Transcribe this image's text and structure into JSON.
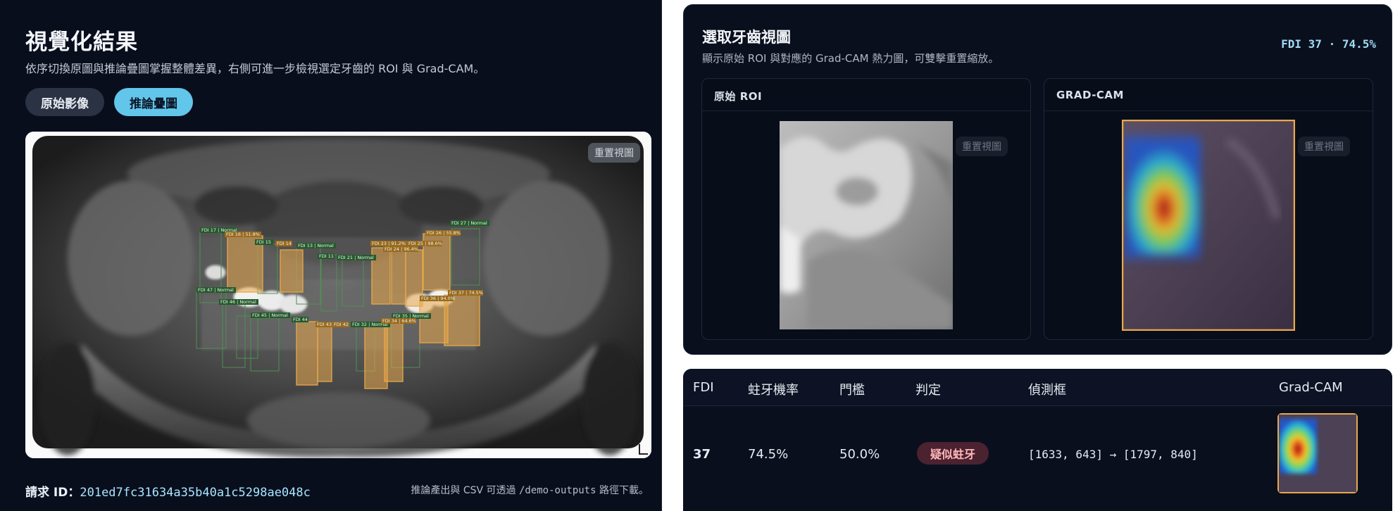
{
  "left": {
    "title": "視覺化結果",
    "subtitle": "依序切換原圖與推論疊圖掌握整體差異，右側可進一步檢視選定牙齒的 ROI 與 Grad-CAM。",
    "toggle_original": "原始影像",
    "toggle_overlay": "推論疊圖",
    "reset_view": "重置視圖",
    "request_label": "請求 ID：",
    "request_id": "201ed7fc31634a35b40a1c5298ae048c",
    "footnote_prefix": "推論產出與 CSV 可透過 ",
    "footnote_path": "/demo-outputs",
    "footnote_suffix": " 路徑下載。",
    "detections": [
      {
        "label": "FDI 17 | Normal",
        "status": "normal"
      },
      {
        "label": "FDI 16 | 51.8%",
        "status": "caries"
      },
      {
        "label": "FDI 15",
        "status": "normal"
      },
      {
        "label": "FDI 14",
        "status": "caries"
      },
      {
        "label": "FDI 13 | Normal",
        "status": "normal"
      },
      {
        "label": "FDI 11",
        "status": "normal"
      },
      {
        "label": "FDI 21 | Normal",
        "status": "normal"
      },
      {
        "label": "FDI 23 | 91.2%",
        "status": "caries"
      },
      {
        "label": "FDI 24 | 96.4%",
        "status": "caries"
      },
      {
        "label": "FDI 25 | 98.6%",
        "status": "caries"
      },
      {
        "label": "FDI 26 | 55.8%",
        "status": "caries"
      },
      {
        "label": "FDI 27 | Normal",
        "status": "normal"
      },
      {
        "label": "FDI 47 | Normal",
        "status": "normal"
      },
      {
        "label": "FDI 46 | Normal",
        "status": "normal"
      },
      {
        "label": "FDI 45 | Normal",
        "status": "normal"
      },
      {
        "label": "FDI 44",
        "status": "normal"
      },
      {
        "label": "FDI 43",
        "status": "caries"
      },
      {
        "label": "FDI 42",
        "status": "caries"
      },
      {
        "label": "FDI 32 | Normal",
        "status": "normal"
      },
      {
        "label": "FDI 35 | Normal",
        "status": "normal"
      },
      {
        "label": "FDI 34 | 64.6%",
        "status": "caries"
      },
      {
        "label": "FDI 36 | 94.0%",
        "status": "caries"
      },
      {
        "label": "FDI 37 | 74.5%",
        "status": "caries"
      }
    ]
  },
  "right": {
    "title": "選取牙齒視圖",
    "subtitle": "顯示原始 ROI 與對應的 Grad-CAM 熱力圖，可雙擊重置縮放。",
    "fdi_tag": "FDI 37 · 74.5%",
    "roi_header": "原始 ROI",
    "gradcam_header": "GRAD-CAM",
    "reset_view": "重置視圖"
  },
  "table": {
    "headers": [
      "FDI",
      "蛀牙機率",
      "門檻",
      "判定",
      "偵測框",
      "Grad-CAM"
    ],
    "rows": [
      {
        "fdi": "37",
        "probability": "74.5%",
        "threshold": "50.0%",
        "verdict": "疑似蛀牙",
        "box": "[1633, 643] → [1797, 840]"
      }
    ]
  },
  "colors": {
    "accent": "#62c6ea",
    "caries_box": "#e8a84a",
    "normal_box": "#4f8f55",
    "verdict_bg": "#4a2230",
    "panel_bg": "#090e1d"
  },
  "icons": [
    "resize-corner-icon"
  ]
}
